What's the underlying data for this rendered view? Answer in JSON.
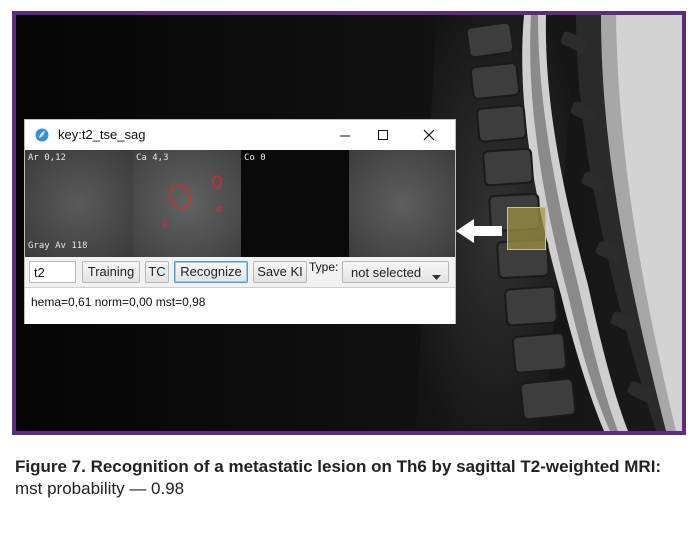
{
  "window": {
    "title": "key:t2_tse_sag",
    "controls": {
      "minimize": "minimize-icon",
      "maximize": "maximize-icon",
      "close": "close-icon"
    }
  },
  "panels": [
    {
      "top_label": "Ar 0,12",
      "bottom_label": "Gray Av 118"
    },
    {
      "top_label": "Ca 4,3"
    },
    {
      "top_label": "Co 0"
    },
    {}
  ],
  "toolbar": {
    "input_value": "t2",
    "buttons": [
      "Training",
      "TC",
      "Recognize",
      "Save KI"
    ],
    "type_label": "Type:",
    "select_value": "not selected"
  },
  "status": {
    "text": "hema=0,61 norm=0,00 mst=0,98"
  },
  "caption": {
    "title": "Figure 7. Recognition of a metastatic lesion on Th6 by sagittal T2-weighted MRI:",
    "subtitle": "mst probability — 0.98"
  },
  "colors": {
    "frame_border": "#5e2c7f",
    "lesion_outline": "#e0262b",
    "roi_fill": "#a4944a",
    "focus_border": "#4f9ad6"
  }
}
